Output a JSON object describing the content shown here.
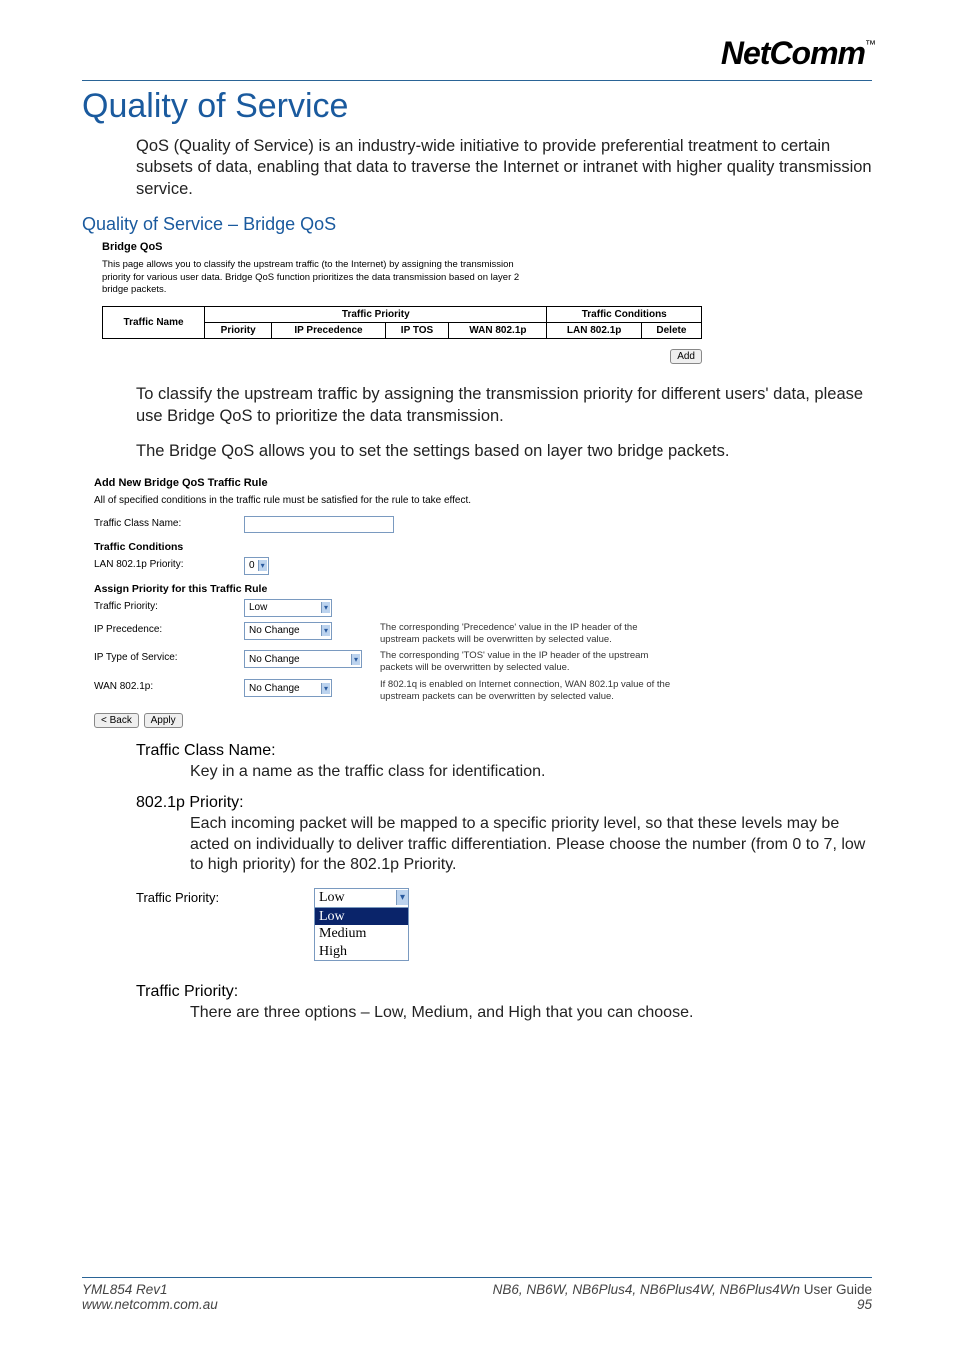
{
  "logo": {
    "text": "NetComm",
    "tm": "™"
  },
  "main_title": "Quality of Service",
  "intro_para": "QoS (Quality of Service) is an industry-wide initiative to provide preferential treatment to certain subsets of data, enabling that data to traverse the Internet or intranet with higher quality transmission service.",
  "sub_title": "Quality of Service – Bridge QoS",
  "ss1": {
    "title": "Bridge QoS",
    "desc": "This page allows you to classify the upstream traffic (to the Internet) by assigning the transmission priority for various user data. Bridge QoS function prioritizes the data transmission based on layer 2 bridge packets.",
    "group_priority": "Traffic Priority",
    "group_conditions": "Traffic Conditions",
    "cols": {
      "name": "Traffic Name",
      "priority": "Priority",
      "ip_prec": "IP Precedence",
      "ip_tos": "IP TOS",
      "wan": "WAN 802.1p",
      "lan": "LAN 802.1p",
      "delete": "Delete"
    },
    "add_btn": "Add"
  },
  "para2": "To classify the upstream traffic by assigning the transmission priority for different users' data, please use Bridge QoS to prioritize the data transmission.",
  "para3": "The Bridge QoS allows you to set the settings based on layer two bridge packets.",
  "ss2": {
    "title": "Add New Bridge QoS Traffic Rule",
    "desc": "All of specified conditions in the traffic rule must be satisfied for the rule to take effect.",
    "class_name_label": "Traffic Class Name:",
    "class_name_value": "",
    "conditions_head": "Traffic Conditions",
    "lan_label": "LAN 802.1p Priority:",
    "lan_value": "0",
    "assign_head": "Assign Priority for this Traffic Rule",
    "tp_label": "Traffic Priority:",
    "tp_value": "Low",
    "ipp_label": "IP Precedence:",
    "ipp_value": "No Change",
    "ipp_note": "The corresponding 'Precedence' value in the IP header of the upstream packets will be overwritten by selected value.",
    "tos_label": "IP Type of Service:",
    "tos_value": "No Change",
    "tos_note": "The corresponding 'TOS' value in the IP header of the upstream packets will be overwritten by selected value.",
    "wan_label": "WAN 802.1p:",
    "wan_value": "No Change",
    "wan_note": "If 802.1q is enabled on Internet connection, WAN 802.1p value of the upstream packets can be overwritten by selected value.",
    "back_btn": "< Back",
    "apply_btn": "Apply"
  },
  "defs": {
    "tcn_head": "Traffic Class Name:",
    "tcn_body": "Key in a name as the traffic class for identification.",
    "p8021_head": "802.1p Priority:",
    "p8021_body": "Each incoming packet will be mapped to a specific priority level, so that these levels may be acted on individually to deliver traffic differentiation. Please choose the number (from 0 to 7, low to high priority) for the 802.1p Priority.",
    "tp_head": "Traffic Priority:",
    "tp_body": "There are three options – Low, Medium, and High that you can choose."
  },
  "dd": {
    "label": "Traffic Priority:",
    "selected": "Low",
    "opt_low": "Low",
    "opt_med": "Medium",
    "opt_high": "High"
  },
  "footer": {
    "left1": "YML854 Rev1",
    "left2": "www.netcomm.com.au",
    "right1a": "NB6, NB6W, NB6Plus4, NB6Plus4W, NB6Plus4Wn ",
    "right1b": "User Guide",
    "right2": "95"
  }
}
